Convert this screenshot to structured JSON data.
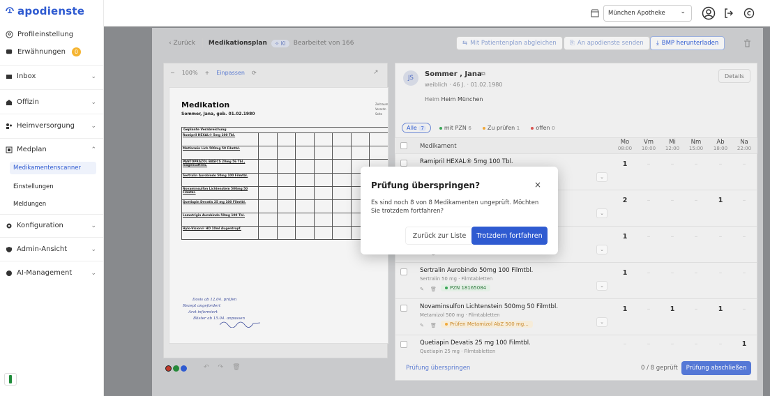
{
  "brand": {
    "name": "apodienste"
  },
  "sidebar": {
    "profile": "Profileinstellung",
    "mentions": "Erwähnungen",
    "mentions_count": "0",
    "items": [
      {
        "label": "Inbox"
      },
      {
        "label": "Offizin"
      },
      {
        "label": "Heimversorgung"
      },
      {
        "label": "Medplan"
      },
      {
        "label": "Konfiguration"
      },
      {
        "label": "Admin-Ansicht"
      },
      {
        "label": "AI-Management"
      }
    ],
    "subitems": [
      "Medikamentenscanner",
      "Einstellungen",
      "Meldungen"
    ]
  },
  "topbar": {
    "store": "München Apotheke"
  },
  "header": {
    "back": "Zurück",
    "title": "Medikationsplan",
    "ki": "KI",
    "editor": "Bearbeitet von 166",
    "btn_compare": "Mit Patientenplan abgleichen",
    "btn_send": "An apodienste senden",
    "btn_bmp": "BMP herunterladen"
  },
  "viewer": {
    "zoom": "100%",
    "fit": "Einpassen"
  },
  "doc": {
    "title": "Medikation",
    "subtitle": "Sommer, Jana, geb. 01.02.1980",
    "side": "Zeitraum Verordn Seite",
    "table_head": "Geplante Verabreichung",
    "rows": [
      "Ramipril HEXAL® 5mg 100 Tbl.",
      "Metformin Lich 500mg 50 Filmtbl.",
      "PANTOPRAZOL BASICS 20mg 56 Tbl., magensaftres.",
      "Sertralin Aurobindo 50mg 100 Filmtbl.",
      "Novaminsulfon Lichtenstein 500mg 50 Filmtbl.",
      "Quetiapin Devatis 25 mg 100 Filmtbl.",
      "Lamotrigin Aurobindo 50mg 100 Tbl.",
      "Hylo-Vision® HD 10ml Augentropf."
    ],
    "notes": [
      "Dosis ab 12.04. prüfen",
      "Rezept angefordert",
      "Arzt informiert",
      "Blister ab 15.04. anpassen"
    ]
  },
  "patient": {
    "initials": "JS",
    "name": "Sommer , Jana",
    "meta": "weiblich · 46 J. · 01.02.1980",
    "heim_label": "Heim",
    "heim": "Heim München",
    "details": "Details"
  },
  "filters": [
    {
      "label": "Alle",
      "count": "7"
    },
    {
      "label": "mit PZN",
      "count": "6"
    },
    {
      "label": "Zu prüfen",
      "count": "1"
    },
    {
      "label": "offen",
      "count": "0"
    }
  ],
  "table": {
    "col_med": "Medikament",
    "cols": [
      {
        "name": "Mo",
        "time": "08:00"
      },
      {
        "name": "Vm",
        "time": "10:00"
      },
      {
        "name": "Mi",
        "time": "12:00"
      },
      {
        "name": "Nm",
        "time": "15:00"
      },
      {
        "name": "Ab",
        "time": "18:00"
      },
      {
        "name": "Na",
        "time": "22:00"
      }
    ],
    "rows": [
      {
        "name": "Ramipril HEXAL® 5mg 100 Tbl.",
        "sub": "",
        "tag": "",
        "doses": [
          "1",
          "–",
          "–",
          "–",
          "–",
          "–"
        ]
      },
      {
        "name": "",
        "sub": "",
        "tag": "",
        "doses": [
          "2",
          "–",
          "–",
          "–",
          "1",
          "–"
        ]
      },
      {
        "name": "tres.",
        "sub": "",
        "tag": "",
        "doses": [
          "1",
          "–",
          "–",
          "–",
          "–",
          "–"
        ]
      },
      {
        "name": "Sertralin Aurobindo 50mg 100 Filmtbl.",
        "sub": "Sertralin 50 mg · Filmtabletten",
        "tag": "PZN 18165084",
        "doses": [
          "1",
          "–",
          "–",
          "–",
          "–",
          "–"
        ]
      },
      {
        "name": "Novaminsulfon Lichtenstein 500mg 50 Filmtbl.",
        "sub": "Metamizol 500 mg · Filmtabletten",
        "tag": "Prüfen Metamizol AbZ 500 mg...",
        "doses": [
          "1",
          "–",
          "1",
          "–",
          "1",
          "–"
        ]
      },
      {
        "name": "Quetiapin Devatis 25 mg 100 Filmtbl.",
        "sub": "Quetiapin 25 mg · Filmtabletten",
        "tag": "",
        "doses": [
          "–",
          "–",
          "–",
          "–",
          "–",
          "1"
        ]
      }
    ]
  },
  "footer": {
    "skip": "Prüfung überspringen",
    "progress": "0 / 8 geprüft",
    "finish": "Prüfung abschließen"
  },
  "modal": {
    "title": "Prüfung überspringen?",
    "body": "Es sind noch 8 von 8 Medikamenten ungeprüft. Möchten Sie trotzdem fortfahren?",
    "cancel": "Zurück zur Liste",
    "confirm": "Trotzdem fortfahren"
  }
}
